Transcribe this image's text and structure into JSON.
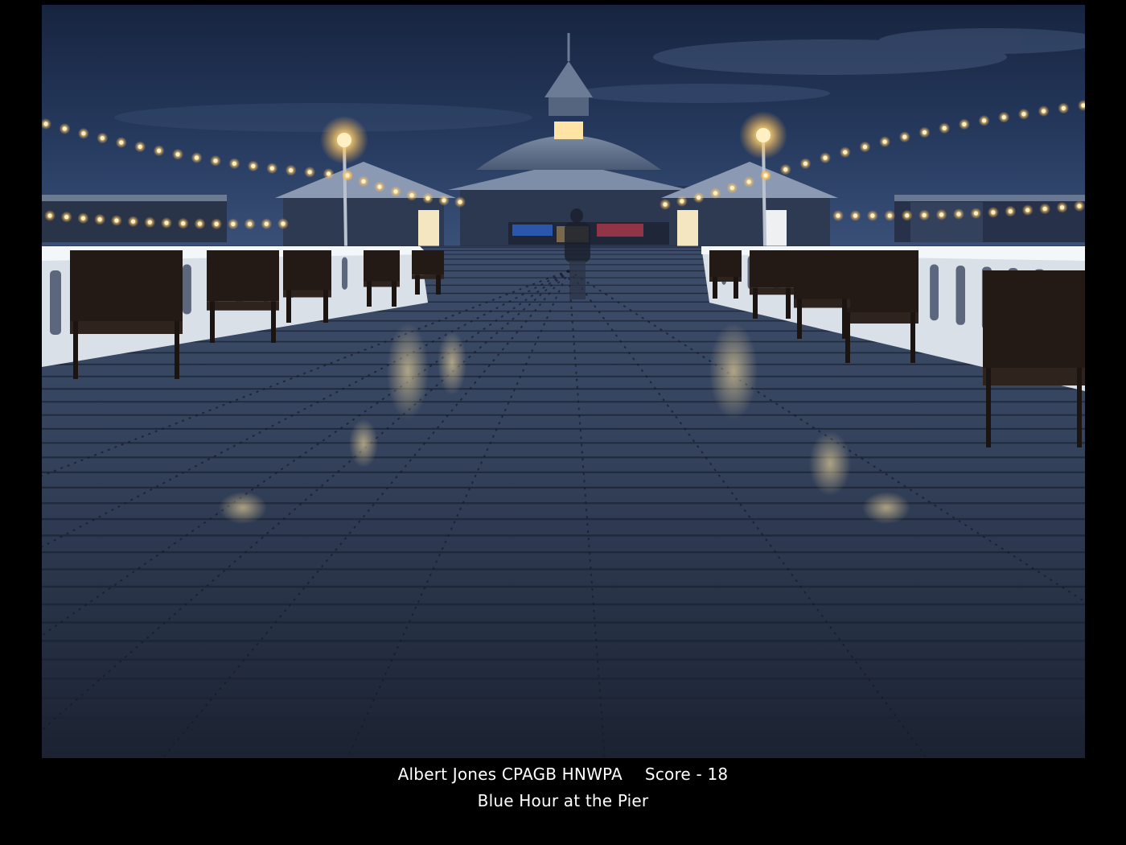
{
  "caption": {
    "author": "Albert Jones CPAGB HNWPA",
    "score": "Score - 18",
    "title": "Blue Hour at the Pier"
  },
  "photo": {
    "subject": "pier-at-blue-hour",
    "colors": {
      "sky_top": "#1b2a48",
      "sky_bottom": "#2c4167",
      "deck_far": "#3a4a66",
      "deck_near": "#1c2433",
      "lamp_glow": "#ffd27a",
      "railing": "#e6ecf2",
      "pavilion": "#8f9fb5"
    }
  }
}
